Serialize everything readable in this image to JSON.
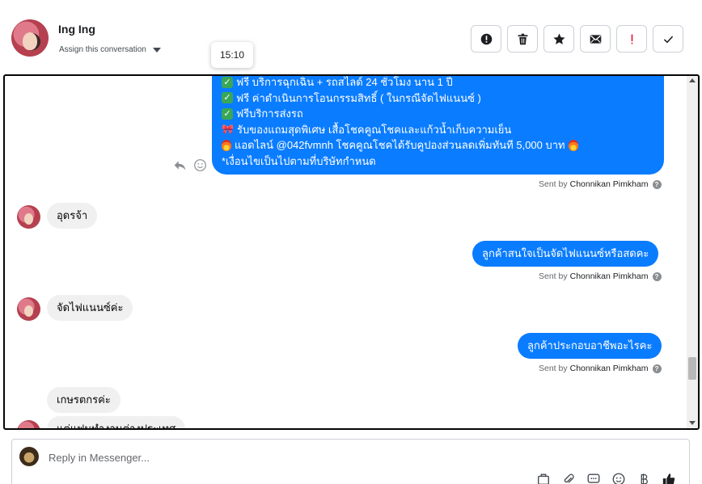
{
  "header": {
    "contact_name": "Ing Ing",
    "assign_label": "Assign this conversation",
    "tooltip_time": "15:10"
  },
  "toolbar": {
    "buttons": [
      {
        "name": "spam-button",
        "icon": "alert-circle-icon"
      },
      {
        "name": "delete-button",
        "icon": "trash-icon"
      },
      {
        "name": "star-button",
        "icon": "star-icon"
      },
      {
        "name": "mark-unread-button",
        "icon": "envelope-icon"
      },
      {
        "name": "follow-up-button",
        "icon": "exclamation-icon",
        "color": "#e41e3f"
      },
      {
        "name": "mark-done-button",
        "icon": "check-icon"
      }
    ]
  },
  "messages": {
    "big_out_lines": [
      {
        "icon": "check-emoji",
        "text": "ฟรี บริการฉุกเฉิน + รถสไลด์ 24 ชั่วโมง นาน 1 ปี"
      },
      {
        "icon": "check-emoji",
        "text": "ฟรี ค่าดำเนินการโอนกรรมสิทธิ์ ( ในกรณีจัดไฟแนนซ์ )"
      },
      {
        "icon": "check-emoji",
        "text": "ฟรีบริการส่งรถ"
      },
      {
        "icon": "ribbon-emoji",
        "text": "รับของแถมสุดพิเศษ เสื้อโชคคูณโชคและแก้วน้ำเก็บความเย็น"
      },
      {
        "icon": "fire-emoji",
        "text": "แอดไลน์ @042fvmnh โชคคูณโชคได้รับคูปองส่วนลดเพิ่มทันที 5,000 บาท"
      },
      {
        "icon": "",
        "text": "*เงื่อนไขเป็นไปตามที่บริษัทกำหนด"
      }
    ],
    "sent_by_prefix": "Sent by",
    "sender_name": "Chonnikan Pimkham",
    "in_1": "อุดรจ้า",
    "out_1": "ลูกค้าสนใจเป็นจัดไฟแนนซ์หรือสดคะ",
    "in_2": "จัดไฟแนนซ์ค่ะ",
    "out_2": "ลูกค้าประกอบอาชีพอะไรคะ",
    "in_3": "เกษรตกรค่ะ",
    "in_4": "แต่แฟนทำงานต่างประเทศ"
  },
  "composer": {
    "placeholder": "Reply in Messenger..."
  },
  "colors": {
    "accent": "#0a7cff",
    "incoming_bubble": "#f0f0f0",
    "follow_up": "#e41e3f"
  }
}
